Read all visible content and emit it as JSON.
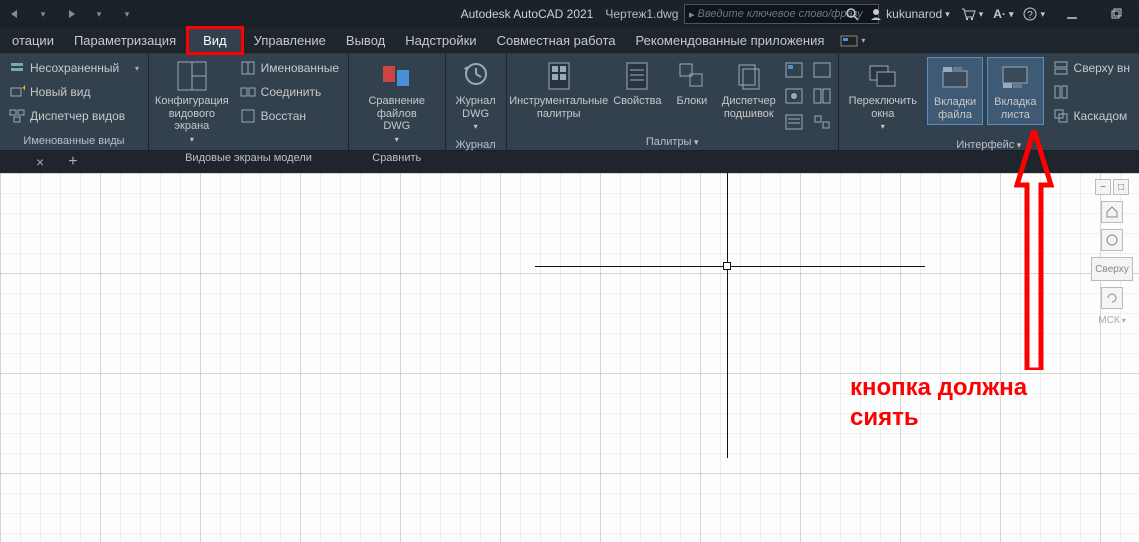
{
  "title": {
    "app": "Autodesk AutoCAD 2021",
    "file": "Чертеж1.dwg"
  },
  "search": {
    "placeholder": "Введите ключевое слово/фразу"
  },
  "user": {
    "name": "kukunarod"
  },
  "menu": {
    "items": [
      "отации",
      "Параметризация",
      "Вид",
      "Управление",
      "Вывод",
      "Надстройки",
      "Совместная работа",
      "Рекомендованные приложения"
    ],
    "active_index": 2,
    "highlighted_index": 2
  },
  "ribbon": {
    "panels": [
      {
        "title": "Именованные виды",
        "rows": [
          {
            "label": "Несохраненный",
            "dd": true,
            "icon": "layer-icon"
          },
          {
            "label": "Новый вид",
            "icon": "new-view-icon"
          },
          {
            "label": "Диспетчер видов",
            "icon": "view-manager-icon"
          }
        ]
      },
      {
        "title": "Видовые экраны модели",
        "big": {
          "label": "Конфигурация\nвидового экрана",
          "icon": "viewport-config-icon",
          "dd": true
        },
        "rows": [
          {
            "label": "Именованные",
            "icon": "named-icon"
          },
          {
            "label": "Соединить",
            "icon": "join-icon"
          },
          {
            "label": "Восстан",
            "icon": "restore-icon"
          }
        ]
      },
      {
        "title": "Сравнить",
        "big": {
          "label": "Сравнение файлов\nDWG",
          "icon": "compare-icon",
          "dd": true
        }
      },
      {
        "title": "Журнал",
        "big": {
          "label": "Журнал\nDWG",
          "icon": "history-icon",
          "dd": true
        }
      },
      {
        "title": "Палитры",
        "dd": true,
        "bigs": [
          {
            "label": "Инструментальные\nпалитры",
            "icon": "tool-palettes-icon"
          },
          {
            "label": "Свойства",
            "icon": "properties-icon"
          },
          {
            "label": "Блоки",
            "icon": "blocks-icon"
          },
          {
            "label": "Диспетчер\nподшивок",
            "icon": "sheet-set-icon"
          }
        ],
        "smallicons": 6
      },
      {
        "title": "Интерфейс",
        "dd": true,
        "bigs": [
          {
            "label": "Переключить\nокна",
            "icon": "switch-windows-icon",
            "dd": true
          },
          {
            "label": "Вкладки\nфайла",
            "icon": "file-tabs-icon",
            "selected": true
          },
          {
            "label": "Вкладка\nлиста",
            "icon": "layout-tab-icon",
            "selected": true
          }
        ],
        "rows": [
          {
            "label": "Сверху вн",
            "icon": "top-icon"
          },
          {
            "label": "",
            "icon": "side-icon"
          },
          {
            "label": "Каскадом",
            "icon": "cascade-icon"
          }
        ]
      }
    ]
  },
  "viewcube": {
    "face": "Сверху",
    "cs": "МСК"
  },
  "annotation": {
    "text": "кнопка должна\nсиять"
  }
}
